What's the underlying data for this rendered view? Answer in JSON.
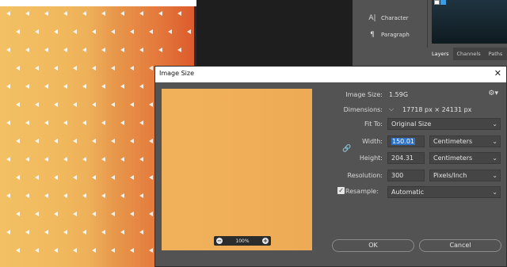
{
  "panels": {
    "character_label": "Character",
    "paragraph_label": "Paragraph",
    "character_icon": "character-icon",
    "paragraph_icon": "paragraph-icon",
    "tabs": [
      "Layers",
      "Channels",
      "Paths"
    ]
  },
  "dialog": {
    "title": "Image Size",
    "close_glyph": "✕",
    "image_size_label": "Image Size:",
    "image_size_value": "1.59G",
    "dimensions_label": "Dimensions:",
    "dimensions_value": "17718 px  ×  24131 px",
    "fit_to_label": "Fit To:",
    "fit_to_value": "Original Size",
    "width_label": "Width:",
    "width_value": "150.01",
    "width_unit": "Centimeters",
    "height_label": "Height:",
    "height_value": "204.31",
    "height_unit": "Centimeters",
    "resolution_label": "Resolution:",
    "resolution_value": "300",
    "resolution_unit": "Pixels/Inch",
    "resample_label": "Resample:",
    "resample_checked": true,
    "resample_value": "Automatic",
    "zoom_value": "100%",
    "ok_label": "OK",
    "cancel_label": "Cancel",
    "gear_glyph": "⚙▾",
    "link_glyph": "🔗"
  },
  "colors": {
    "dialog_bg": "#535353",
    "selection": "#2d72c6",
    "preview_fill": "#f0ae58"
  }
}
